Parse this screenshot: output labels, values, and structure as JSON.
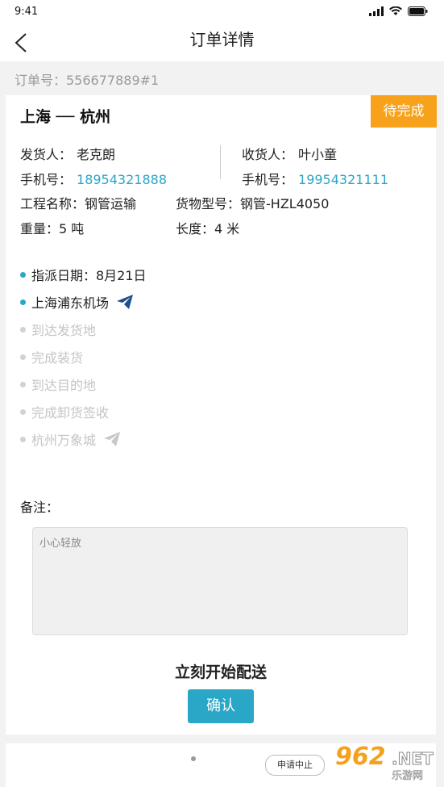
{
  "status_bar": {
    "time": "9:41"
  },
  "nav": {
    "title": "订单详情"
  },
  "order": {
    "number_label": "订单号：556677889#1"
  },
  "route": {
    "text": "上海 ── 杭州",
    "status": "待完成"
  },
  "sender": {
    "label": "发货人：",
    "name": "老克朗",
    "phone_label": "手机号：",
    "phone": "18954321888"
  },
  "receiver": {
    "label": "收货人：",
    "name": "叶小童",
    "phone_label": "手机号：",
    "phone": "19954321111"
  },
  "project": {
    "label": "工程名称：",
    "value": "钢管运输"
  },
  "model": {
    "label": "货物型号：",
    "value": "钢管-HZL4050"
  },
  "weight": {
    "label": "重量：",
    "value": "5 吨"
  },
  "length": {
    "label": "长度：",
    "value": "4 米"
  },
  "timeline": [
    {
      "text": "指派日期：8月21日",
      "state": "active"
    },
    {
      "text": "上海浦东机场",
      "state": "active",
      "icon": "paper-plane-icon"
    },
    {
      "text": "到达发货地",
      "state": "inactive"
    },
    {
      "text": "完成装货",
      "state": "inactive"
    },
    {
      "text": "到达目的地",
      "state": "inactive"
    },
    {
      "text": "完成卸货签收",
      "state": "inactive"
    },
    {
      "text": "杭州万象城",
      "state": "inactive",
      "icon": "paper-plane-icon"
    }
  ],
  "remark": {
    "label": "备注：",
    "value": "小心轻放"
  },
  "action": {
    "prompt": "立刻开始配送",
    "confirm_label": "确认"
  },
  "bottom": {
    "abort_label": "申请中止"
  },
  "watermark": {
    "num": "962",
    "net": ".NET",
    "sub": "乐游网"
  },
  "colors": {
    "accent": "#2aa6c7",
    "badge": "#f7a21a"
  }
}
